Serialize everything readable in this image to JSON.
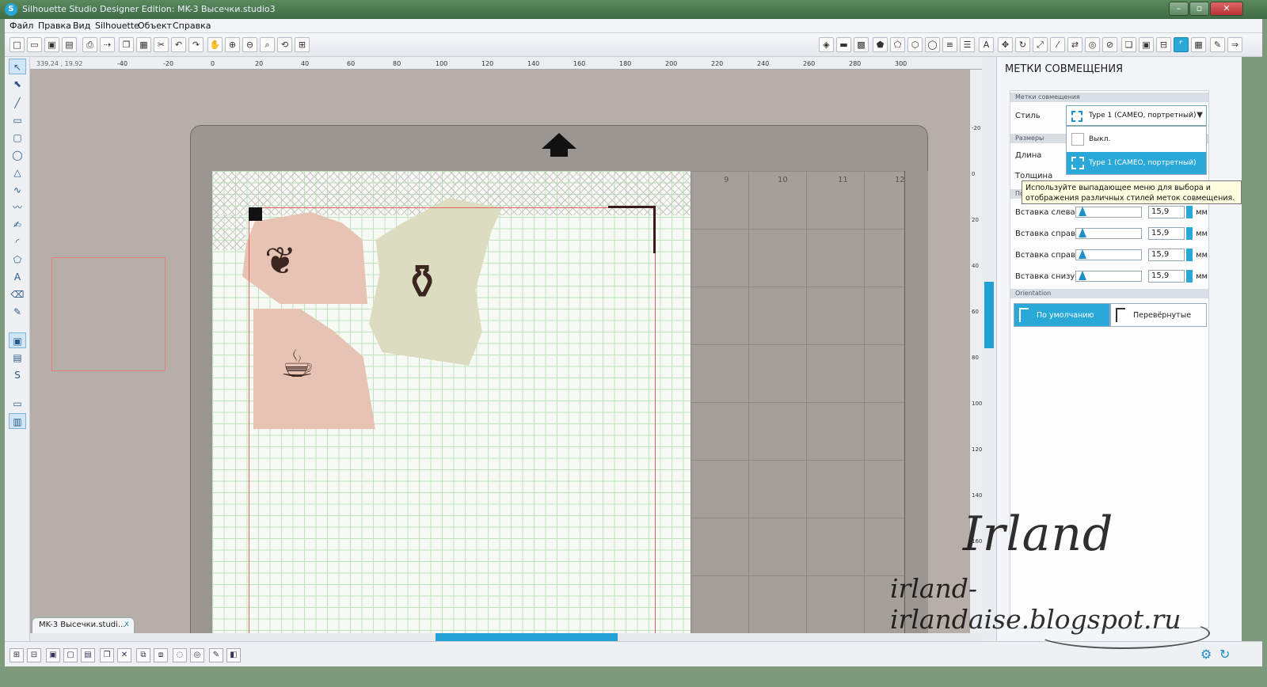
{
  "window": {
    "title": "Silhouette Studio Designer Edition: MK-3 Высечки.studio3",
    "min": "–",
    "max": "▫",
    "close": "✕"
  },
  "menu": [
    "Файл",
    "Правка",
    "Вид",
    "Silhouette",
    "Объект",
    "Справка"
  ],
  "ruler": {
    "coords": "339.24 , 19.92",
    "top_ticks": [
      "-40",
      "-20",
      "0",
      "20",
      "40",
      "60",
      "80",
      "100",
      "120",
      "140",
      "160",
      "180",
      "200",
      "220",
      "240",
      "260",
      "280",
      "300"
    ],
    "right_ticks": [
      "-20",
      "0",
      "20",
      "40",
      "60",
      "80",
      "100",
      "120",
      "140",
      "160"
    ],
    "cols": [
      "9",
      "10",
      "11",
      "12"
    ]
  },
  "document_tab": {
    "label": "MK-3 Высечки.studi...",
    "close": "x"
  },
  "panel": {
    "title": "МЕТКИ СОВМЕЩЕНИЯ",
    "section_marks": "Метки совмещения",
    "style_label": "Стиль",
    "style_value": "Type 1 (CAMEO, портретный)",
    "section_sizes": "Размеры",
    "length_label": "Длина",
    "thickness_label": "Толщина",
    "section_inset": "По",
    "dropdown_options": [
      "Выкл.",
      "Type 1 (CAMEO, портретный)"
    ],
    "tooltip": "Используйте выпадающее меню для выбора и отображения различных стилей меток совмещения.",
    "insets": [
      {
        "label": "Вставка слева",
        "value": "15,9",
        "unit": "мм"
      },
      {
        "label": "Вставка справа",
        "value": "15,9",
        "unit": "мм"
      },
      {
        "label": "Вставка справа",
        "value": "15,9",
        "unit": "мм"
      },
      {
        "label": "Вставка снизу",
        "value": "15,9",
        "unit": "мм"
      }
    ],
    "section_orientation": "Orientation",
    "orientation_default": "По умолчанию",
    "orientation_flipped": "Перевёрнутые"
  },
  "watermark": {
    "name": "Irland",
    "url": "irland-irlandaise.blogspot.ru"
  },
  "colors": {
    "accent": "#2aa8d8",
    "reg_line": "#e45e5e"
  }
}
